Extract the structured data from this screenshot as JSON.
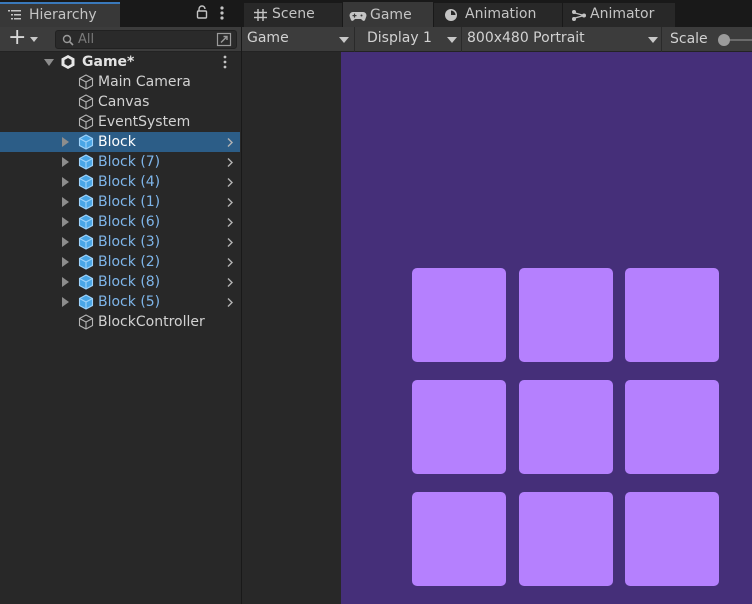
{
  "hierarchy": {
    "tab_label": "Hierarchy",
    "search": {
      "placeholder": "All",
      "value": ""
    },
    "add_button_label": "+",
    "scene": {
      "name": "Game*"
    },
    "items": [
      {
        "name": "Main Camera",
        "prefab": false,
        "expandable": false,
        "selected": false
      },
      {
        "name": "Canvas",
        "prefab": false,
        "expandable": false,
        "selected": false
      },
      {
        "name": "EventSystem",
        "prefab": false,
        "expandable": false,
        "selected": false
      },
      {
        "name": "Block",
        "prefab": true,
        "expandable": true,
        "selected": true
      },
      {
        "name": "Block (7)",
        "prefab": true,
        "expandable": true,
        "selected": false
      },
      {
        "name": "Block (4)",
        "prefab": true,
        "expandable": true,
        "selected": false
      },
      {
        "name": "Block (1)",
        "prefab": true,
        "expandable": true,
        "selected": false
      },
      {
        "name": "Block (6)",
        "prefab": true,
        "expandable": true,
        "selected": false
      },
      {
        "name": "Block (3)",
        "prefab": true,
        "expandable": true,
        "selected": false
      },
      {
        "name": "Block (2)",
        "prefab": true,
        "expandable": true,
        "selected": false
      },
      {
        "name": "Block (8)",
        "prefab": true,
        "expandable": true,
        "selected": false
      },
      {
        "name": "Block (5)",
        "prefab": true,
        "expandable": true,
        "selected": false
      },
      {
        "name": "BlockController",
        "prefab": false,
        "expandable": false,
        "selected": false
      }
    ]
  },
  "tabs": [
    {
      "label": "Scene",
      "icon": "grid-icon",
      "active": false
    },
    {
      "label": "Game",
      "icon": "gamepad-icon",
      "active": true
    },
    {
      "label": "Animation",
      "icon": "clock-icon",
      "active": false
    },
    {
      "label": "Animator",
      "icon": "animator-icon",
      "active": false
    }
  ],
  "game_toolbar": {
    "mode": "Game",
    "display": "Display 1",
    "resolution": "800x480 Portrait",
    "scale_label": "Scale"
  },
  "game_view": {
    "background_color": "#452f79",
    "block_color": "#b580fe",
    "grid_rows": 3,
    "grid_cols": 3
  },
  "colors": {
    "selection": "#2c5d87",
    "prefab_text": "#7fb6ea",
    "prefab_icon": "#4aa6e6"
  }
}
